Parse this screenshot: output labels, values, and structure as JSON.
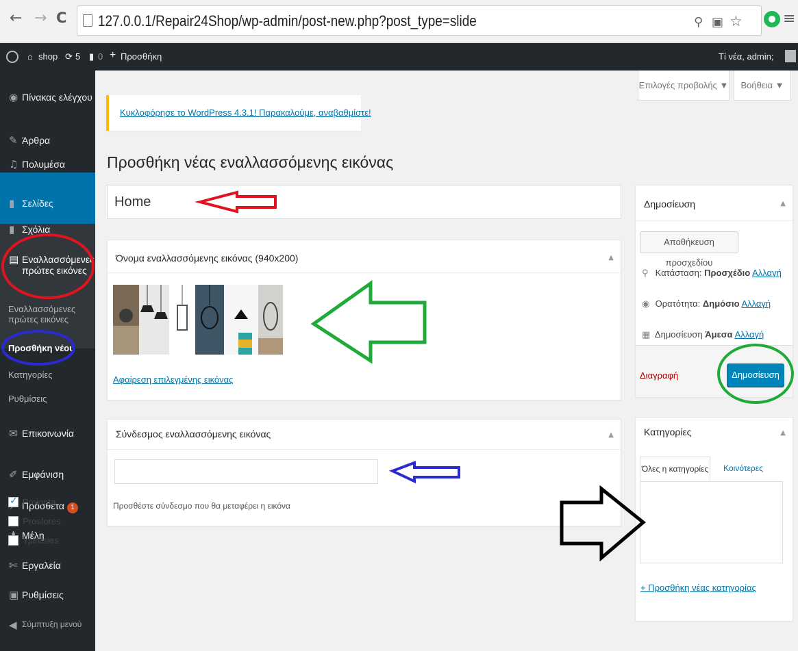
{
  "browser": {
    "url": "127.0.0.1/Repair24Shop/wp-admin/post-new.php?post_type=slide",
    "back": "←",
    "forward": "→",
    "reload": "C",
    "menu": "≡"
  },
  "admin_bar": {
    "site": "shop",
    "updates": "5",
    "comments": "0",
    "new": "Προσθήκη",
    "greeting": "Τί νέα, admin;"
  },
  "sidebar": {
    "items": [
      {
        "label": "Πίνακας ελέγχου",
        "icon": "dashboard-icon"
      },
      {
        "label": "Άρθρα",
        "icon": "pin-icon"
      },
      {
        "label": "Πολυμέσα",
        "icon": "media-icon"
      },
      {
        "label": "Σελίδες",
        "icon": "page-icon"
      },
      {
        "label": "Σχόλια",
        "icon": "comment-icon"
      },
      {
        "label": "Εναλλασσόμενες πρώτες εικόνες",
        "icon": "slides-icon"
      },
      {
        "label": "Επικοινωνία",
        "icon": "mail-icon"
      },
      {
        "label": "Εμφάνιση",
        "icon": "brush-icon"
      },
      {
        "label": "Πρόσθετα",
        "icon": "plugin-icon",
        "badge": "1"
      },
      {
        "label": "Μέλη",
        "icon": "user-icon"
      },
      {
        "label": "Εργαλεία",
        "icon": "wrench-icon"
      },
      {
        "label": "Ρυθμίσεις",
        "icon": "settings-icon"
      },
      {
        "label": "Σύμπτυξη μενού",
        "icon": "collapse-icon"
      }
    ],
    "submenu": [
      "Εναλλασσόμενες πρώτες εικόνες",
      "Προσθήκη νέου",
      "Κατηγορίες",
      "Ρυθμίσεις"
    ]
  },
  "screen_options": "Επιλογές προβολής ▼",
  "help": "Βοήθεια ▼",
  "notice": {
    "text": "Κυκλοφόρησε το WordPress 4.3.1!",
    "link": "Παρακαλούμε, αναβαθμίστε!"
  },
  "page_title": "Προσθήκη νέας εναλλασσόμενης εικόνας",
  "title_value": "Home",
  "image_box": {
    "title": "Όνομα εναλλασσόμενης εικόνας (940x200)",
    "remove_link": "Αφαίρεση επιλεγμένης εικόνας"
  },
  "link_box": {
    "title": "Σύνδεσμος εναλλασσόμενης εικόνας",
    "value": "",
    "help": "Προσθέστε σύνδεσμο που θα μεταφέρει η εικόνα"
  },
  "publish_box": {
    "title": "Δημοσίευση",
    "save_draft": "Αποθήκευση προσχεδίου",
    "status_label": "Κατάσταση:",
    "status_value": "Προσχέδιο",
    "visibility_label": "Ορατότητα:",
    "visibility_value": "Δημόσιο",
    "publish_label": "Δημοσίευση",
    "publish_value": "Άμεσα",
    "edit": "Αλλαγή",
    "delete": "Διαγραφή",
    "publish_button": "Δημοσίευση"
  },
  "categories_box": {
    "title": "Κατηγορίες",
    "tab_all": "Όλες η κατηγορίες",
    "tab_popular": "Κοινότερες",
    "items": [
      {
        "label": "Proionta",
        "checked": true
      },
      {
        "label": "Prosfores",
        "checked": false
      },
      {
        "label": "Ypiresies",
        "checked": false
      }
    ],
    "add_new": "+ Προσθήκη νέας κατηγορίας"
  },
  "colors": {
    "sidebar": "#23282d",
    "active": "#0073aa",
    "primary_button": "#0085ba",
    "link": "#0073aa",
    "annotation_red": "#e0141e",
    "annotation_green": "#1faa3a",
    "annotation_blue": "#2a2ad0",
    "annotation_black": "#000000"
  }
}
